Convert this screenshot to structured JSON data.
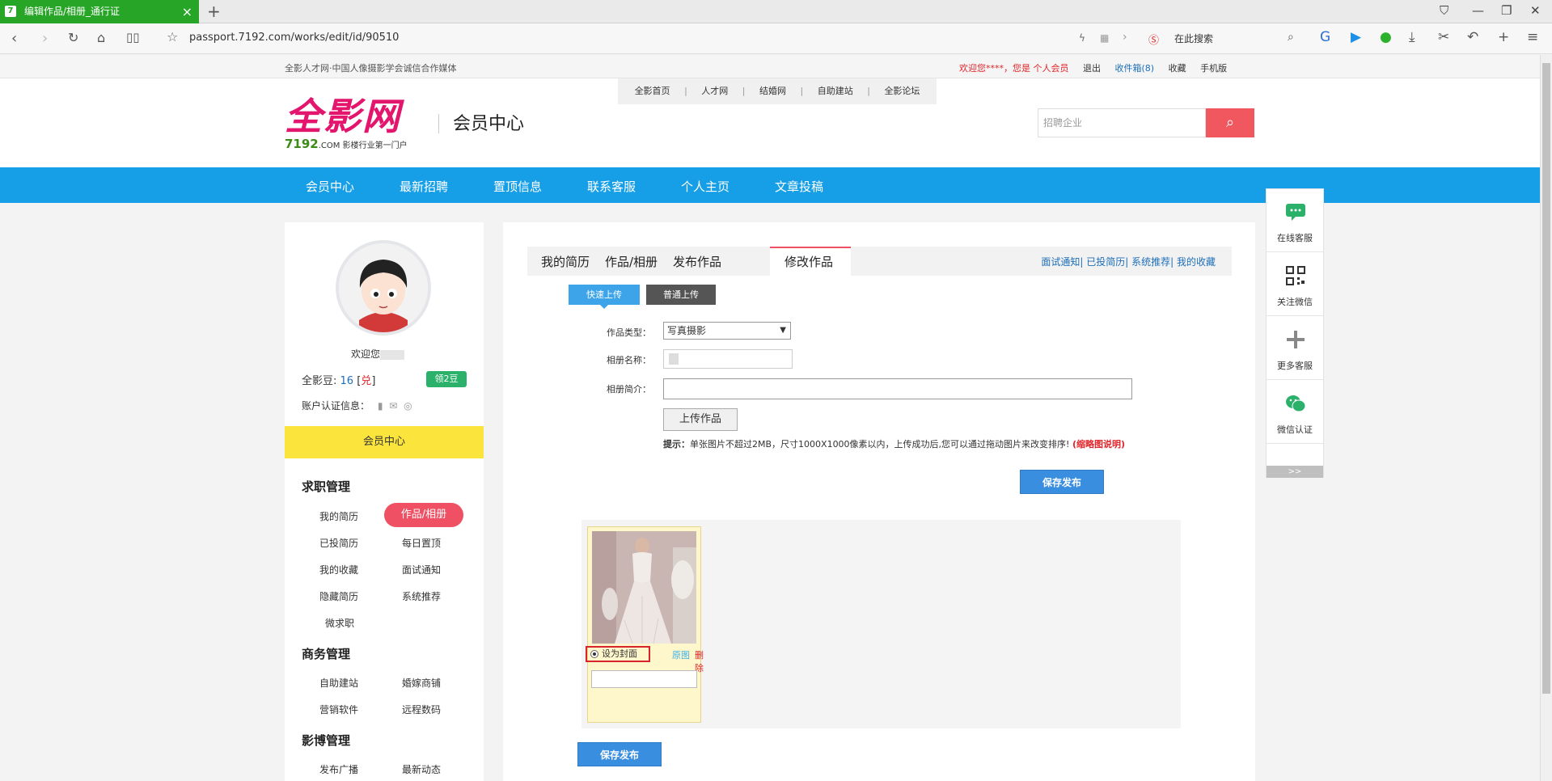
{
  "browser": {
    "tab_title": "编辑作品/相册_通行证",
    "tab_favicon": "7192",
    "url": "passport.7192.com/works/edit/id/90510",
    "search_placeholder": "在此搜索"
  },
  "topstrip": {
    "slogan": "全影人才网·中国人像摄影学会诚信合作媒体",
    "welcome": "欢迎您****，您是 个人会员",
    "logout": "退出",
    "inbox": "收件箱(8)",
    "favorites": "收藏",
    "mobile": "手机版"
  },
  "header": {
    "subnav": [
      "全影首页",
      "人才网",
      "结婚网",
      "自助建站",
      "全影论坛"
    ],
    "logo_text": "全影网",
    "logo_domain": "7192",
    "logo_domain_suffix": ".COM",
    "logo_tagline": "影楼行业第一门户",
    "center_title": "会员中心",
    "search_placeholder": "招聘企业"
  },
  "mainnav": [
    "会员中心",
    "最新招聘",
    "置顶信息",
    "联系客服",
    "个人主页",
    "文章投稿"
  ],
  "sidebar": {
    "welcome": "欢迎您",
    "beans_label": "全影豆:",
    "beans_value": "16",
    "beans_exchange": "兑",
    "get_beans": "领2豆",
    "cert_label": "账户认证信息：",
    "member_center": "会员中心",
    "groups": [
      {
        "title": "求职管理",
        "items": [
          "我的简历",
          "作品/相册",
          "已投简历",
          "每日置顶",
          "我的收藏",
          "面试通知",
          "隐藏简历",
          "系统推荐",
          "微求职"
        ]
      },
      {
        "title": "商务管理",
        "items": [
          "自助建站",
          "婚嫁商铺",
          "营销软件",
          "远程数码"
        ]
      },
      {
        "title": "影博管理",
        "items": [
          "发布广播",
          "最新动态"
        ]
      }
    ]
  },
  "main": {
    "tabs": [
      "我的简历",
      "作品/相册",
      "发布作品",
      "修改作品"
    ],
    "tab_links": [
      "面试通知",
      "已投简历",
      "系统推荐",
      "我的收藏"
    ],
    "fast_upload": "快速上传",
    "normal_upload": "普通上传",
    "label_type": "作品类型：",
    "type_value": "写真摄影",
    "label_name": "相册名称：",
    "label_intro": "相册简介：",
    "upload_btn": "上传作品",
    "tip_prefix": "提示：",
    "tip_text": "单张图片不超过2MB，尺寸1000X1000像素以内，上传成功后,您可以通过拖动图片来改变排序!",
    "tip_link": "(缩略图说明)",
    "save_publish": "保存发布",
    "set_cover": "设为封面",
    "original": "原图",
    "delete": "删除"
  },
  "rightbar": {
    "items": [
      "在线客服",
      "关注微信",
      "更多客服",
      "微信认证"
    ],
    "more": ">>"
  },
  "colors": {
    "accent_blue": "#169fe6",
    "brand_pink": "#e3156d",
    "active_red": "#f05064",
    "yellow": "#fbe43c"
  }
}
